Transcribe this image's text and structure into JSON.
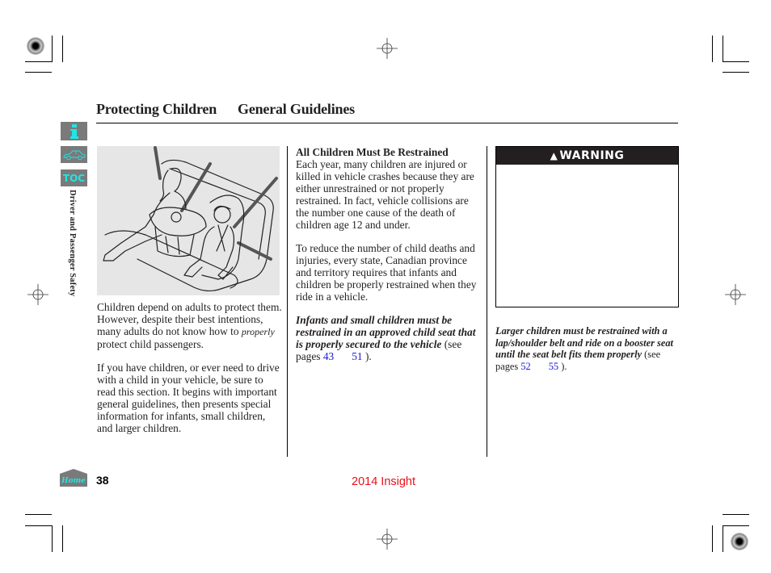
{
  "header": {
    "section": "Protecting Children",
    "subsection": "General Guidelines"
  },
  "nav": {
    "info_icon": "info-icon",
    "car_icon": "car-icon",
    "toc_label": "TOC",
    "side_label": "Driver and Passenger Safety",
    "home_label": "Home"
  },
  "figure": {
    "description": "Illustration of a woman with an infant in a rear-facing carrier and a child in a forward-facing child seat on a rear seat"
  },
  "column1": {
    "para1_before": "Children depend on adults to protect them. However, despite their best intentions, many adults do not know how to ",
    "para1_em": "properly",
    "para1_after": " protect child passengers.",
    "para2": "If you have children, or ever need to drive with a child in your vehicle, be sure to read this section. It begins with important general guidelines, then presents special information for infants, small children, and larger children."
  },
  "column2": {
    "heading": "All Children Must Be Restrained",
    "para1": "Each year, many children are injured or killed in vehicle crashes because they are either unrestrained or not properly restrained. In fact, vehicle collisions are the number one cause of the death of children age 12 and under.",
    "para2": "To reduce the number of child deaths and injuries, every state, Canadian province and territory requires that infants and children be properly restrained when they ride in a vehicle.",
    "para3_bold": "Infants and small children must be restrained in an approved child seat that is properly secured to the vehicle",
    "para3_ref_prefix": " (see pages ",
    "para3_page_a": "43",
    "para3_page_b": "51",
    "para3_ref_suffix": " )."
  },
  "column3": {
    "warning_label": "WARNING",
    "para_bold": "Larger children must be restrained with a lap/shoulder belt and ride on a booster seat until the seat belt fits them properly",
    "ref_prefix": " (see pages ",
    "page_a": "52",
    "page_b": "55",
    "ref_suffix": " )."
  },
  "footer": {
    "page_number": "38",
    "model": "2014 Insight"
  },
  "colors": {
    "nav_bg": "#7a7a7a",
    "nav_fg": "#21e5e5",
    "link": "#1a1adb",
    "model_text": "#e8101a",
    "figure_bg": "#e6e6e6"
  }
}
